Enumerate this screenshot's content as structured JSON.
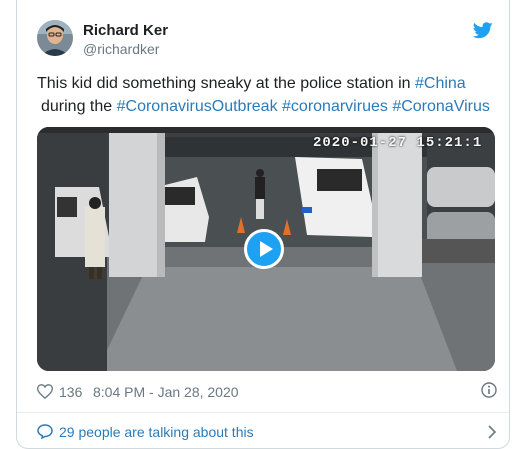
{
  "author": {
    "name": "Richard Ker",
    "handle": "@richardker",
    "avatar_icon": "profile-photo"
  },
  "brand": {
    "icon": "twitter-bird-icon",
    "color": "#1da1f2"
  },
  "tweet": {
    "text_before": "This kid did something sneaky at the police station in ",
    "hashtag_china": "#China",
    "text_middle": "during the ",
    "hashtag_1": "#CoronavirusOutbreak",
    "hashtag_2": "#coronarvirues",
    "hashtag_3": "#CoronaVirus",
    "link_color": "#2b7bb9"
  },
  "media": {
    "type": "video",
    "overlay_timestamp": "2020-01-27 15:21:1",
    "play_icon": "play-icon"
  },
  "meta": {
    "likes": "136",
    "timestamp": "8:04 PM - Jan 28, 2020",
    "heart_icon": "heart-icon",
    "info_icon": "info-icon"
  },
  "conversation": {
    "label": "29 people are talking about this",
    "bubble_icon": "comment-bubble-icon",
    "chevron_icon": "chevron-right-icon"
  }
}
